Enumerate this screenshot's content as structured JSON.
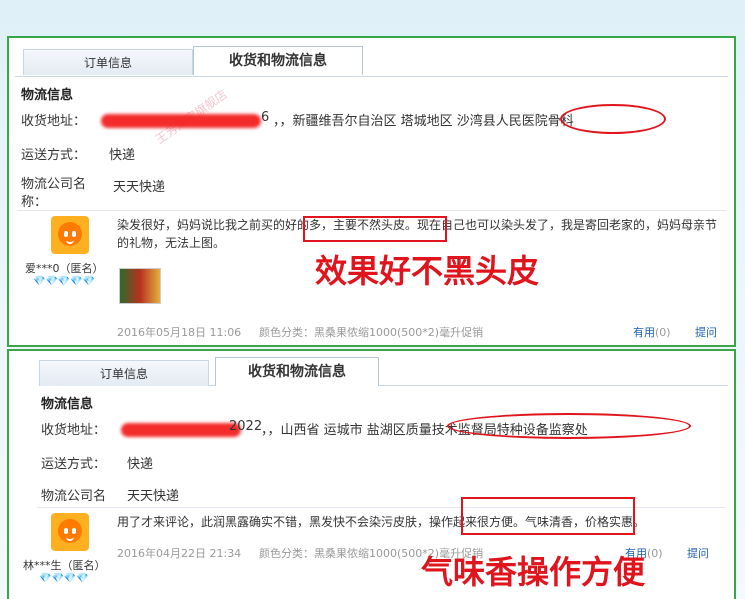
{
  "panels": [
    {
      "tabs": {
        "order_info": "订单信息",
        "shipping_info": "收货和物流信息"
      },
      "section_title": "物流信息",
      "address_label": "收货地址：",
      "address_value": "，，新疆维吾尔自治区  塔城地区  沙湾县人民医院骨科",
      "address_visible_fragment": "6",
      "shipping_method_label": "运送方式：",
      "shipping_method_value": "快递",
      "logistics_label": "物流公司名称：",
      "logistics_value": "天天快递",
      "watermark": "王芳淘宝旗舰店",
      "review": {
        "username": "爱***0（匿名）",
        "hearts": "💎💎💎💎💎",
        "text": "染发很好，妈妈说比我之前买的好的多，主要不然头皮。现在自己也可以染头发了，我是寄回老家的，妈妈母亲节的礼物，无法上图。",
        "date": "2016年05月18日 11:06",
        "variant": "颜色分类：黑桑果侬缩1000(500*2)毫升促销",
        "helpful_label": "有用",
        "helpful_count": "(0)",
        "reply_label": "提问"
      },
      "annotation": "效果好不黑头皮"
    },
    {
      "tabs": {
        "order_info": "订单信息",
        "shipping_info": "收货和物流信息"
      },
      "section_title": "物流信息",
      "address_label": "收货地址：",
      "address_value": "，，山西省  运城市  盐湖区质量技术监督局特种设备监察处",
      "address_visible_fragment": "2022",
      "shipping_method_label": "运送方式：",
      "shipping_method_value": "快递",
      "logistics_label": "物流公司名",
      "logistics_value": "天天快递",
      "review": {
        "username": "林***生（匿名）",
        "hearts": "💎💎💎💎",
        "text": "用了才来评论，此润黑露确实不错，黑发快不会染污皮肤，操作起来很方便。气味清香，价格实惠。",
        "date": "2016年04月22日 21:34",
        "variant": "颜色分类：黑桑果侬缩1000(500*2)毫升促销",
        "helpful_label": "有用",
        "helpful_count": "(0)",
        "reply_label": "提问"
      },
      "annotation": "气味香操作方便"
    }
  ]
}
